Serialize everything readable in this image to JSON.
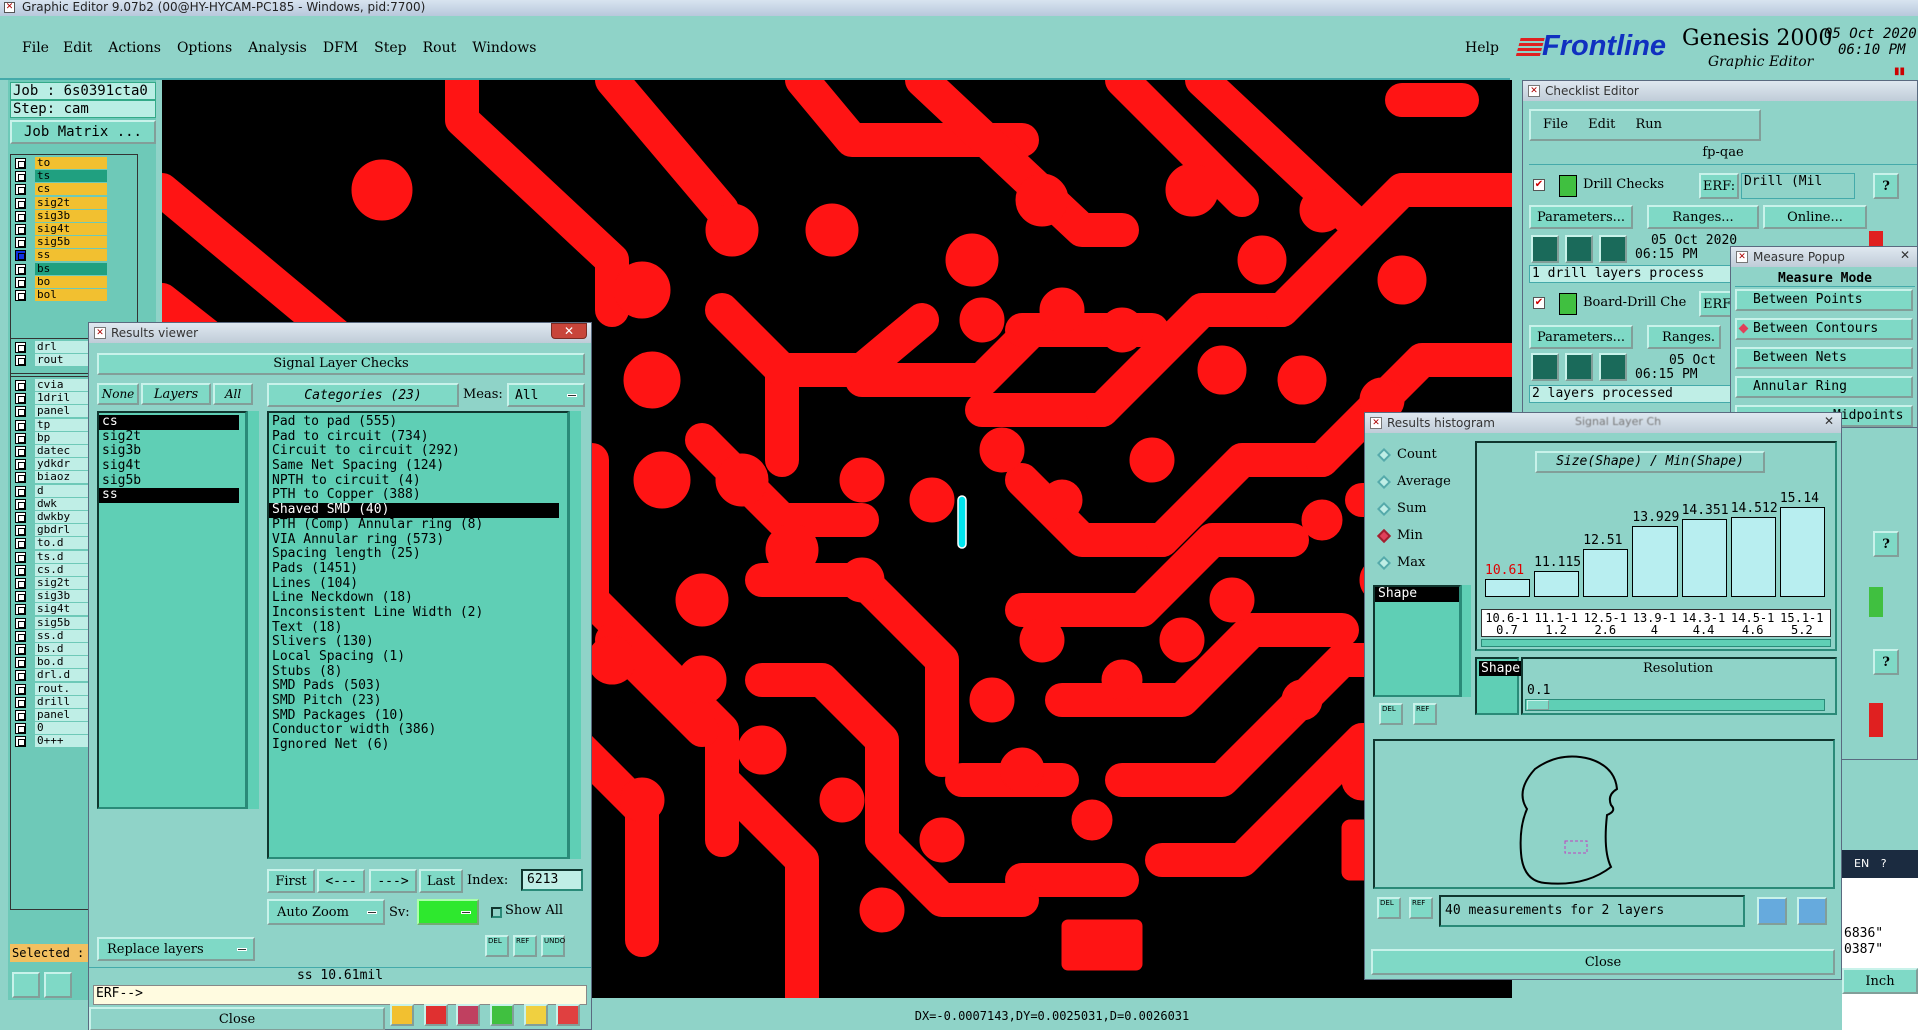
{
  "titlebar": {
    "text": "Graphic Editor 9.07b2 (00@HY-HYCAM-PC185 - Windows, pid:7700)"
  },
  "menubar": {
    "items": [
      "File",
      "Edit",
      "Actions",
      "Options",
      "Analysis",
      "DFM",
      "Step",
      "Rout",
      "Windows"
    ],
    "help": "Help"
  },
  "brand": {
    "logo": "Frontline",
    "product": "Genesis 2000",
    "subtitle": "Graphic Editor",
    "date": "05 Oct 2020",
    "time": "06:10 PM"
  },
  "job": {
    "job_label": "Job : 6s0391cta0",
    "step_label": "Step: cam",
    "matrix_button": "Job Matrix ..."
  },
  "layers": {
    "board": [
      "to",
      "ts",
      "cs",
      "sig2t",
      "sig3b",
      "sig4t",
      "sig5b",
      "ss",
      "bs",
      "bo",
      "bol"
    ],
    "drill": [
      "drl",
      "rout"
    ],
    "misc": [
      "cvia",
      "1dril",
      "panel",
      "tp",
      "bp",
      "datec",
      "ydkdr",
      "biaoz",
      "d",
      "dwk",
      "dwkby",
      "gbdrl",
      "to.d",
      "ts.d",
      "cs.d",
      "sig2t",
      "sig3b",
      "sig4t",
      "sig5b",
      "ss.d",
      "bs.d",
      "bo.d",
      "drl.d",
      "rout.",
      "drill",
      "panel",
      "0",
      "0+++"
    ],
    "selected_label": "Selected :"
  },
  "results_viewer": {
    "title": "Results viewer",
    "heading": "Signal Layer Checks",
    "none_btn": "None",
    "layers_btn": "Layers",
    "all_btn": "All",
    "categories_btn": "Categories (23)",
    "meas_label": "Meas:",
    "meas_value": "All",
    "layer_list": [
      "cs",
      "sig2t",
      "sig3b",
      "sig4t",
      "sig5b",
      "ss"
    ],
    "categories": [
      "Pad to pad (555)",
      "Pad to circuit (734)",
      "Circuit to circuit (292)",
      "Same Net Spacing (124)",
      "NPTH to circuit (4)",
      "PTH to Copper (388)",
      "Shaved SMD (40)",
      "PTH (Comp) Annular ring (8)",
      "VIA Annular ring (573)",
      "Spacing length (25)",
      "Pads (1451)",
      "Lines (104)",
      "Line Neckdown (18)",
      "Inconsistent Line Width (2)",
      "Text (18)",
      "Slivers (130)",
      "Local Spacing (1)",
      "Stubs (8)",
      "SMD Pads (503)",
      "SMD Pitch (23)",
      "SMD Packages (10)",
      "Conductor width (386)",
      "Ignored Net (6)"
    ],
    "selected_category": "Shaved SMD (40)",
    "nav": {
      "first": "First",
      "prev": "<---",
      "next": "--->",
      "last": "Last",
      "index_label": "Index:",
      "index_value": "6213"
    },
    "auto_zoom": "Auto Zoom",
    "sv_label": "Sv:",
    "show_all": "Show All",
    "replace_layers": "Replace layers",
    "status": "ss 10.61mil",
    "erf": "ERF-->",
    "close": "Close",
    "icons": [
      "DEL",
      "REF",
      "UNDO"
    ]
  },
  "checklist_editor": {
    "title": "Checklist Editor",
    "menu": [
      "File",
      "Edit",
      "Run"
    ],
    "name": "fp-qae",
    "checks": [
      {
        "name": "Drill Checks",
        "erf_label": "ERF:",
        "erf_value": "Drill (Mil",
        "params": "Parameters...",
        "ranges": "Ranges...",
        "online": "Online...",
        "date": "05 Oct 2020",
        "time": "06:15 PM",
        "status": "1 drill layers process"
      },
      {
        "name": "Board-Drill Che",
        "erf_label": "ERF",
        "params": "Parameters...",
        "ranges": "Ranges.",
        "date": "05 Oct",
        "time": "06:15 PM",
        "status": "2 layers processed"
      }
    ],
    "help": "?"
  },
  "measure_popup": {
    "title": "Measure Popup",
    "heading": "Measure Mode",
    "items": [
      "Between Points",
      "Between Contours",
      "Between Nets",
      "Annular Ring",
      "Midpoints"
    ],
    "selected": "Between Contours"
  },
  "histogram": {
    "title": "Results histogram",
    "tab_behind": "Signal Layer Ch",
    "modes": [
      "Count",
      "Average",
      "Sum",
      "Min",
      "Max"
    ],
    "selected_mode": "Min",
    "attr_list": [
      "Shape"
    ],
    "chart_title": "Size(Shape) / Min(Shape)",
    "resolution_label": "Resolution",
    "resolution_value": "0.1",
    "attr_field": "Shape",
    "measurements": "40 measurements for 2 layers",
    "close": "Close",
    "icons": [
      "DEL",
      "REF"
    ]
  },
  "chart_data": {
    "type": "bar",
    "title": "Size(Shape) / Min(Shape)",
    "categories": [
      "10.6-10.7",
      "11.1-11.2",
      "12.5-12.6",
      "13.9-14",
      "14.3-14.4",
      "14.5-14.6",
      "15.1-15.2"
    ],
    "values": [
      10.61,
      11.115,
      12.51,
      13.929,
      14.351,
      14.512,
      15.14
    ],
    "value_labels": [
      "10.61",
      "11.115",
      "12.51",
      "13.929",
      "14.351",
      "14.512",
      "15.14"
    ],
    "highlight_color": "#e00000",
    "bar_color": "#b8eef0",
    "ylim": [
      0,
      16
    ]
  },
  "status_bar": {
    "coords": "DX=-0.0007143,DY=0.0025031,D=0.0026031"
  },
  "right_edge": {
    "units": "Inch",
    "tray": "EN",
    "coord1": "6836\"",
    "coord2": "0387\""
  },
  "colors": {
    "background": "#8fd3c8",
    "copper": "#ff1414",
    "board": "#000000",
    "highlight": "#00e5ee"
  }
}
